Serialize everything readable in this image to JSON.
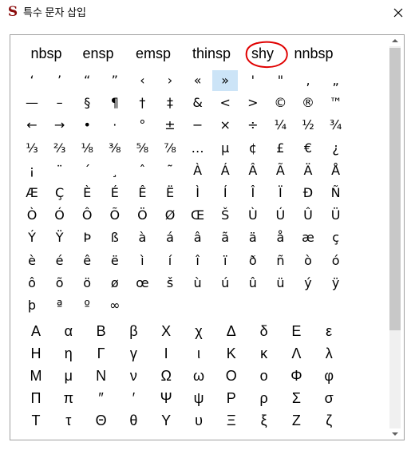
{
  "window": {
    "title": "특수 문자 삽입",
    "app_icon": "S"
  },
  "spaces": [
    "nbsp",
    "ensp",
    "emsp",
    "thinsp",
    "shy",
    "nnbsp"
  ],
  "symbols": [
    [
      "‘",
      "’",
      "“",
      "”",
      "‹",
      "›",
      "«",
      "»",
      "'",
      "\"",
      ",",
      "„"
    ],
    [
      "—",
      "–",
      "§",
      "¶",
      "†",
      "‡",
      "&",
      "<",
      ">",
      "©",
      "®",
      "™"
    ],
    [
      "←",
      "→",
      "•",
      "·",
      "°",
      "±",
      "−",
      "×",
      "÷",
      "¼",
      "½",
      "¾"
    ],
    [
      "⅓",
      "⅔",
      "⅛",
      "⅜",
      "⅝",
      "⅞",
      "…",
      "µ",
      "¢",
      "£",
      "€",
      "¿"
    ],
    [
      "¡",
      "¨",
      "´",
      "¸",
      "ˆ",
      "˜",
      "À",
      "Á",
      "Â",
      "Ã",
      "Ä",
      "Å"
    ],
    [
      "Æ",
      "Ç",
      "È",
      "É",
      "Ê",
      "Ë",
      "Ì",
      "Í",
      "Î",
      "Ï",
      "Đ",
      "Ñ"
    ],
    [
      "Ò",
      "Ó",
      "Ô",
      "Õ",
      "Ö",
      "Ø",
      "Œ",
      "Š",
      "Ù",
      "Ú",
      "Û",
      "Ü"
    ],
    [
      "Ý",
      "Ÿ",
      "Þ",
      "ß",
      "à",
      "á",
      "â",
      "ã",
      "ä",
      "å",
      "æ",
      "ç"
    ],
    [
      "è",
      "é",
      "ê",
      "ë",
      "ì",
      "í",
      "î",
      "ï",
      "ð",
      "ñ",
      "ò",
      "ó"
    ],
    [
      "ô",
      "õ",
      "ö",
      "ø",
      "œ",
      "š",
      "ù",
      "ú",
      "û",
      "ü",
      "ý",
      "ÿ"
    ],
    [
      "þ",
      "ª",
      "º",
      "∞"
    ]
  ],
  "selected_symbol": "»",
  "greek": [
    [
      "Α",
      "α",
      "Β",
      "β",
      "Χ",
      "χ",
      "Δ",
      "δ",
      "Ε",
      "ε"
    ],
    [
      "Η",
      "η",
      "Γ",
      "γ",
      "Ι",
      "ι",
      "Κ",
      "κ",
      "Λ",
      "λ"
    ],
    [
      "Μ",
      "μ",
      "Ν",
      "ν",
      "Ω",
      "ω",
      "Ο",
      "ο",
      "Φ",
      "φ"
    ],
    [
      "Π",
      "π",
      "″",
      "′",
      "Ψ",
      "ψ",
      "Ρ",
      "ρ",
      "Σ",
      "σ"
    ],
    [
      "Τ",
      "τ",
      "Θ",
      "θ",
      "Υ",
      "υ",
      "Ξ",
      "ξ",
      "Ζ",
      "ζ"
    ]
  ],
  "colors": {
    "selection": "#cce4f7",
    "annotation": "#e00000",
    "icon": "#8b0a0a"
  }
}
